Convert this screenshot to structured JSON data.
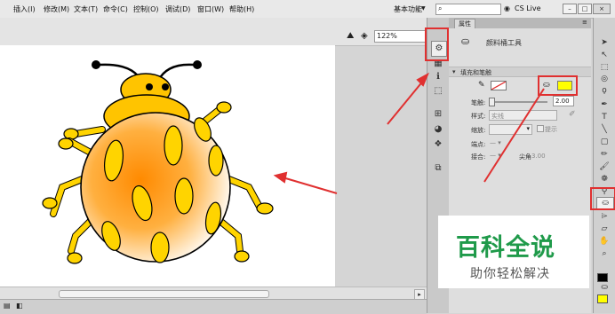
{
  "menu": {
    "items": [
      "插入(I)",
      "修改(M)",
      "文本(T)",
      "命令(C)",
      "控制(O)",
      "调试(D)",
      "窗口(W)",
      "帮助(H)"
    ],
    "workspace": "基本功能",
    "search_placeholder": "",
    "cs_live": "CS Live"
  },
  "stage": {
    "zoom": "122%"
  },
  "properties": {
    "tab_label": "属性",
    "tool_name": "颜料桶工具",
    "section_title": "填充和笔触",
    "stroke_label": "笔触:",
    "stroke_value": "2.00",
    "style_label": "样式:",
    "style_value": "实线",
    "scale_label": "缩放:",
    "hint_label": "提示",
    "cap_label": "端点:",
    "join_label": "接合:",
    "miter_label": "尖角",
    "miter_value": "3.00"
  },
  "colors": {
    "fill": "#ffff00",
    "annotation": "#e03030",
    "beetle_body": "#ffb000",
    "beetle_spots": "#ffd400"
  },
  "watermark": {
    "title": "百科全说",
    "subtitle": "助你轻松解决"
  }
}
